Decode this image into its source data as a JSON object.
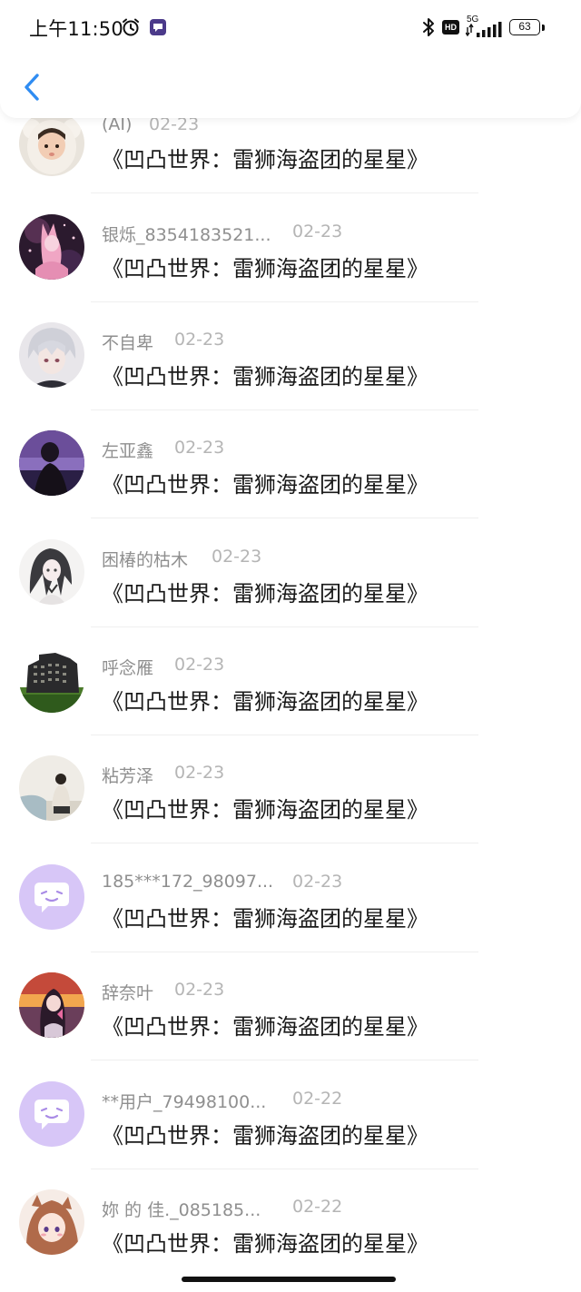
{
  "status_bar": {
    "time": "上午11:50",
    "network": "5G",
    "hd": "HD",
    "battery": "63"
  },
  "icons": {
    "back": "back-chevron-icon",
    "alarm": "alarm-clock-icon",
    "bluetooth": "bluetooth-icon",
    "signal": "signal-strength-icon",
    "default_avatar": "chat-bubble-face-icon"
  },
  "colors": {
    "accent": "#2f8cf2",
    "name_text": "#8f8f8f",
    "date_text": "#b5b5b5",
    "default_avatar_bg": "#d7c6f7"
  },
  "list": {
    "items": [
      {
        "name": "(AI)",
        "date": "02-23",
        "title": "《凹凸世界：雷狮海盗团的星星》"
      },
      {
        "name": "银烁_8354183521...",
        "date": "02-23",
        "title": "《凹凸世界：雷狮海盗团的星星》"
      },
      {
        "name": "不自卑",
        "date": "02-23",
        "title": "《凹凸世界：雷狮海盗团的星星》"
      },
      {
        "name": "左亚鑫",
        "date": "02-23",
        "title": "《凹凸世界：雷狮海盗团的星星》"
      },
      {
        "name": "困椿的枯木",
        "date": "02-23",
        "title": "《凹凸世界：雷狮海盗团的星星》"
      },
      {
        "name": "呼念雁",
        "date": "02-23",
        "title": "《凹凸世界：雷狮海盗团的星星》"
      },
      {
        "name": "粘芳泽",
        "date": "02-23",
        "title": "《凹凸世界：雷狮海盗团的星星》"
      },
      {
        "name": "185***172_98097...",
        "date": "02-23",
        "title": "《凹凸世界：雷狮海盗团的星星》"
      },
      {
        "name": "辞奈叶",
        "date": "02-23",
        "title": "《凹凸世界：雷狮海盗团的星星》"
      },
      {
        "name": "**用户_79498100...",
        "date": "02-22",
        "title": "《凹凸世界：雷狮海盗团的星星》"
      },
      {
        "name": "妳 的 佳._085185...",
        "date": "02-22",
        "title": "《凹凸世界：雷狮海盗团的星星》"
      }
    ]
  }
}
